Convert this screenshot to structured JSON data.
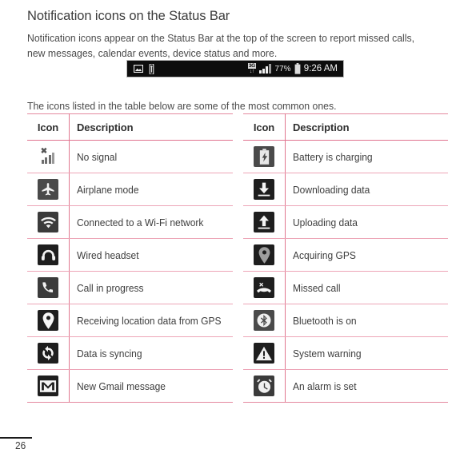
{
  "page": {
    "title": "Notification icons on the Status Bar",
    "intro_paragraph": "Notification icons appear on the Status Bar at the top of the screen to report missed calls, new messages, calendar events, device status and more.",
    "below_figure_paragraph": "The icons listed in the table below are some of the most common ones.",
    "page_number": "26"
  },
  "status_bar_figure": {
    "left_icons": [
      {
        "icon": "picture-image-icon"
      },
      {
        "icon": "usb-connected-icon"
      }
    ],
    "network_label": "3G",
    "network_arrows": "↓↑",
    "signal_icon": "signal-bars-icon",
    "battery_percent": "77%",
    "battery_icon": "battery-icon",
    "time": "9:26 AM"
  },
  "tables": {
    "headers": {
      "icon": "Icon",
      "description": "Description"
    },
    "left_rows": [
      {
        "icon": "no-signal-icon",
        "description": "No signal"
      },
      {
        "icon": "airplane-mode-icon",
        "description": "Airplane mode"
      },
      {
        "icon": "wifi-connected-icon",
        "description": "Connected to a Wi-Fi network"
      },
      {
        "icon": "wired-headset-icon",
        "description": "Wired headset"
      },
      {
        "icon": "call-in-progress-icon",
        "description": "Call in progress"
      },
      {
        "icon": "gps-location-icon",
        "description": "Receiving location data from GPS"
      },
      {
        "icon": "sync-icon",
        "description": "Data is syncing"
      },
      {
        "icon": "gmail-message-icon",
        "description": "New Gmail message"
      }
    ],
    "right_rows": [
      {
        "icon": "battery-charging-icon",
        "description": "Battery is charging"
      },
      {
        "icon": "download-icon",
        "description": "Downloading data"
      },
      {
        "icon": "upload-icon",
        "description": "Uploading data"
      },
      {
        "icon": "gps-acquiring-icon",
        "description": "Acquiring GPS"
      },
      {
        "icon": "missed-call-icon",
        "description": "Missed call"
      },
      {
        "icon": "bluetooth-icon",
        "description": "Bluetooth is on"
      },
      {
        "icon": "system-warning-icon",
        "description": "System warning"
      },
      {
        "icon": "alarm-set-icon",
        "description": "An alarm is set"
      }
    ]
  },
  "colors": {
    "table_border_pink": "#e4899f",
    "table_rule_pink": "#eda5b7",
    "icon_tile_dark": "#1e1e1e",
    "icon_tile_gray": "#3b3b3b",
    "text_primary": "#3d3d3d",
    "status_bar_bg": "#0d0d0d"
  }
}
